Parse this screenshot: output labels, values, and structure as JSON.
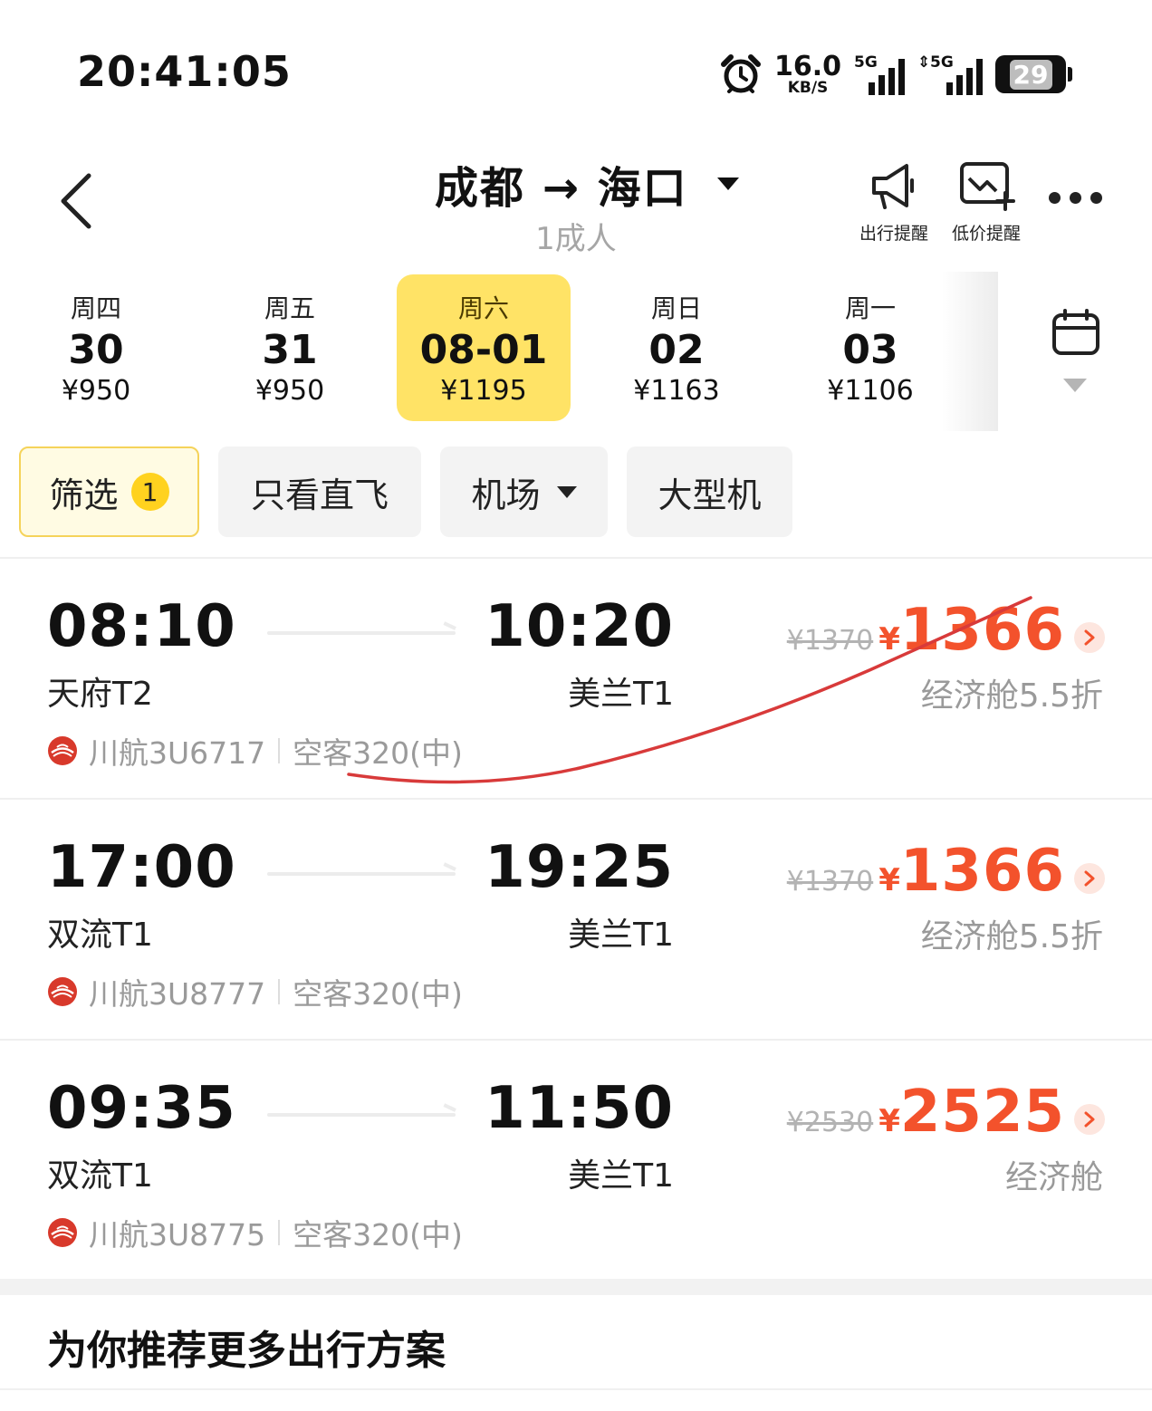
{
  "status_bar": {
    "time": "20:41:05",
    "net_speed": "16.0",
    "net_unit": "KB/S",
    "sim1_label": "5G",
    "sim2_label": "5G",
    "battery": "29"
  },
  "header": {
    "route": "成都 → 海口",
    "passengers": "1成人",
    "actions": [
      {
        "label": "出行提醒",
        "icon": "megaphone-icon"
      },
      {
        "label": "低价提醒",
        "icon": "price-alert-icon"
      }
    ]
  },
  "dates": [
    {
      "weekday": "周四",
      "date": "30",
      "price": "¥950",
      "active": false
    },
    {
      "weekday": "周五",
      "date": "31",
      "price": "¥950",
      "active": false
    },
    {
      "weekday": "周六",
      "date": "08-01",
      "price": "¥1195",
      "active": true
    },
    {
      "weekday": "周日",
      "date": "02",
      "price": "¥1163",
      "active": false
    },
    {
      "weekday": "周一",
      "date": "03",
      "price": "¥1106",
      "active": false
    }
  ],
  "filters": {
    "filter_label": "筛选",
    "filter_count": "1",
    "direct_only": "只看直飞",
    "airport": "机场",
    "large_aircraft": "大型机"
  },
  "flights": [
    {
      "dep_time": "08:10",
      "arr_time": "10:20",
      "dep_airport": "天府T2",
      "arr_airport": "美兰T1",
      "airline_flight": "川航3U6717",
      "aircraft": "空客320(中)",
      "old_price": "¥1370",
      "currency": "¥",
      "price": "1366",
      "cabin": "经济舱5.5折"
    },
    {
      "dep_time": "17:00",
      "arr_time": "19:25",
      "dep_airport": "双流T1",
      "arr_airport": "美兰T1",
      "airline_flight": "川航3U8777",
      "aircraft": "空客320(中)",
      "old_price": "¥1370",
      "currency": "¥",
      "price": "1366",
      "cabin": "经济舱5.5折"
    },
    {
      "dep_time": "09:35",
      "arr_time": "11:50",
      "dep_airport": "双流T1",
      "arr_airport": "美兰T1",
      "airline_flight": "川航3U8775",
      "aircraft": "空客320(中)",
      "old_price": "¥2530",
      "currency": "¥",
      "price": "2525",
      "cabin": "经济舱"
    }
  ],
  "recommend_title": "为你推荐更多出行方案",
  "colors": {
    "accent_yellow": "#ffe366",
    "price_red": "#f3522c",
    "annotation_red": "#d83a3a"
  }
}
